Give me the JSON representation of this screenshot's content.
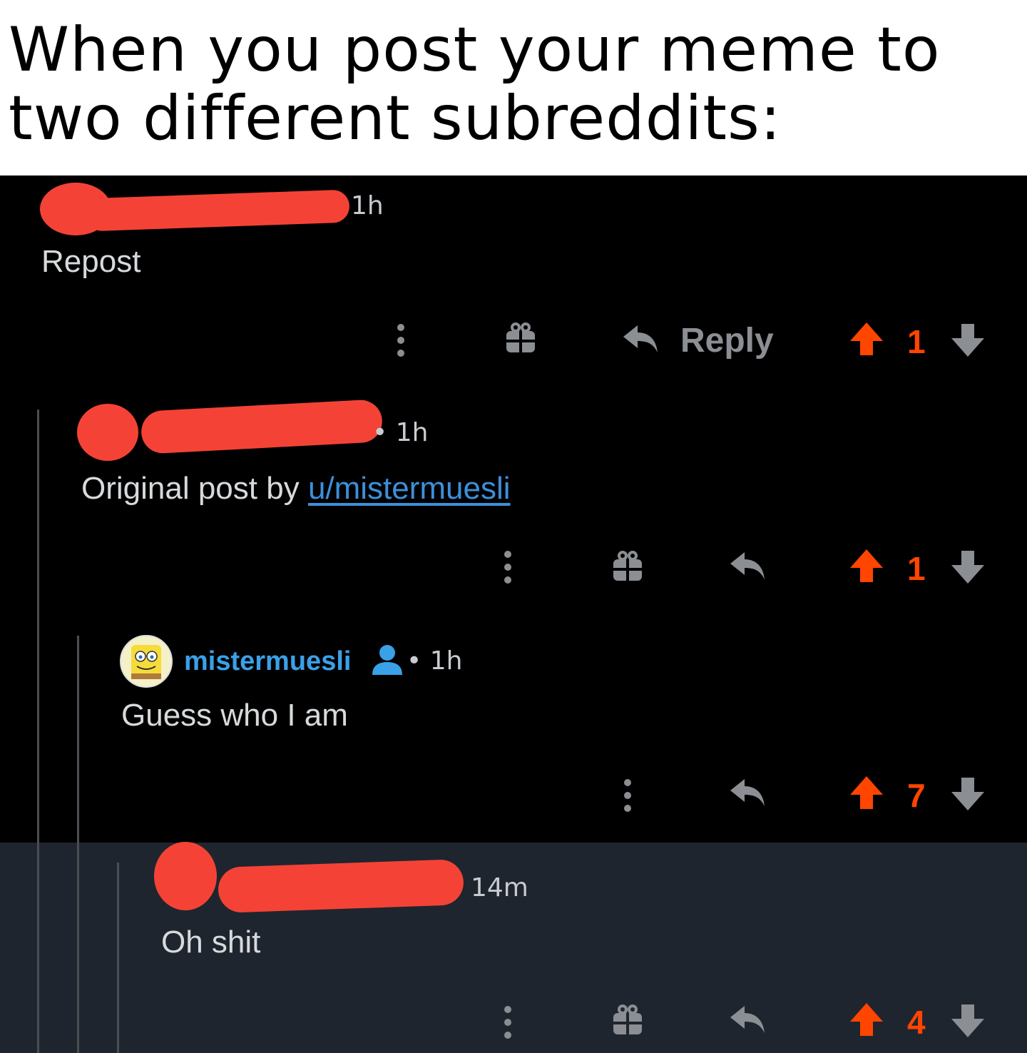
{
  "caption": {
    "line1": "When you post your meme to",
    "line2": "two different subreddits:"
  },
  "comments": [
    {
      "time": "1h",
      "body": "Repost",
      "reply_label": "Reply",
      "votes": "1",
      "has_award": true
    },
    {
      "time": "1h",
      "body_prefix": "Original post by ",
      "body_link": "u/mistermuesli",
      "votes": "1",
      "has_award": true
    },
    {
      "username": "mistermuesli",
      "separator": "•",
      "time": "1h",
      "body": "Guess who I am",
      "votes": "7",
      "has_award": false
    },
    {
      "time": "14m",
      "body": "Oh shit",
      "votes": "4",
      "has_award": true
    }
  ],
  "colors": {
    "upvote": "#ff4500",
    "icon_gray": "#8b8e93",
    "username": "#3aa0e8",
    "redaction": "#f44336",
    "highlight_bg": "#1f252e"
  },
  "icons": [
    "more-vertical-icon",
    "award-gift-icon",
    "reply-arrow-icon",
    "upvote-arrow-icon",
    "downvote-arrow-icon",
    "op-user-icon"
  ]
}
